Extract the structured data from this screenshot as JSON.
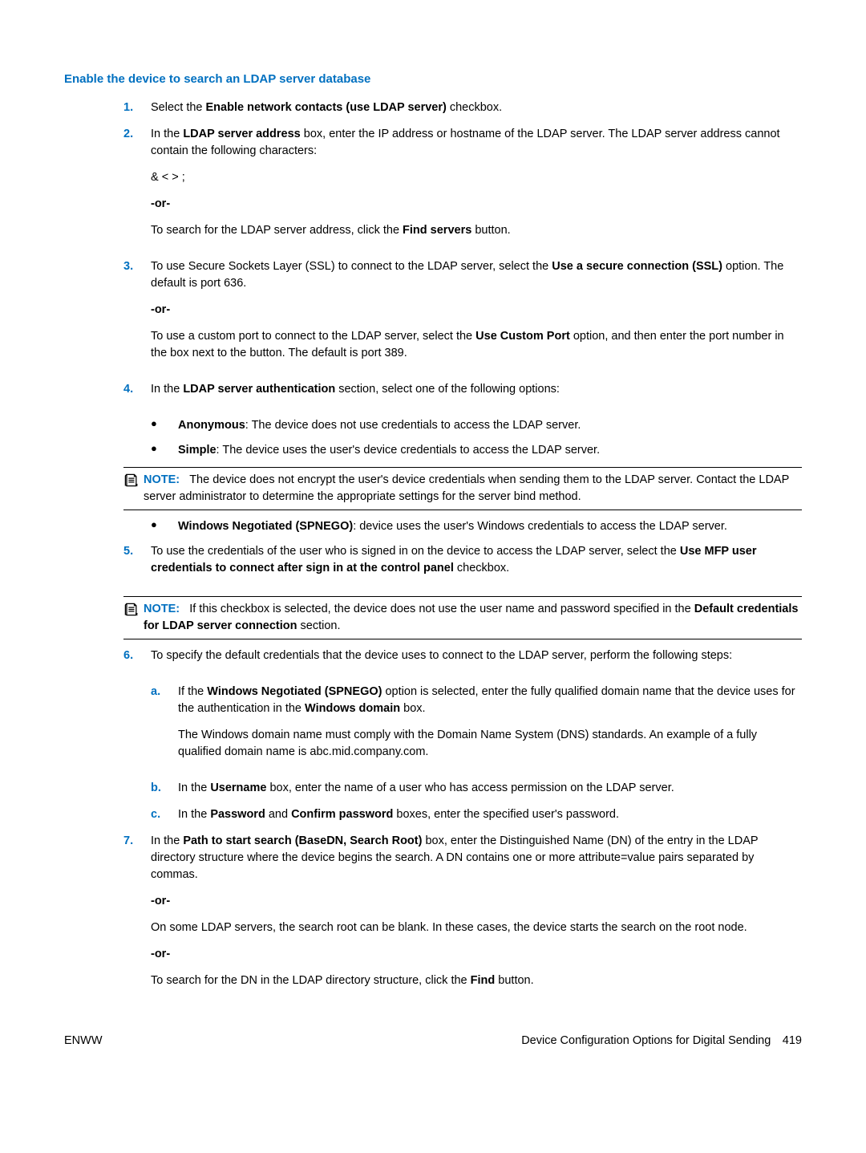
{
  "heading": "Enable the device to search an LDAP server database",
  "steps": {
    "s1": {
      "num": "1.",
      "text": "Select the <b>Enable network contacts (use LDAP server)</b> checkbox."
    },
    "s2": {
      "num": "2.",
      "text": "In the <b>LDAP server address</b> box, enter the IP address or hostname of the LDAP server. The LDAP server address cannot contain the following characters:",
      "chars": "& < > ;",
      "or": "-or-",
      "search": "To search for the LDAP server address, click the <b>Find servers</b> button."
    },
    "s3": {
      "num": "3.",
      "text": "To use Secure Sockets Layer (SSL) to connect to the LDAP server, select the <b>Use a secure connection (SSL)</b> option. The default is port 636.",
      "or": "-or-",
      "custom": "To use a custom port to connect to the LDAP server, select the <b>Use Custom Port</b> option, and then enter the port number in the box next to the button. The default is port 389."
    },
    "s4": {
      "num": "4.",
      "text": "In the <b>LDAP server authentication</b> section, select one of the following options:",
      "b1": "<b>Anonymous</b>: The device does not use credentials to access the LDAP server.",
      "b2": "<b>Simple</b>: The device uses the user's device credentials to access the LDAP server.",
      "note_label": "NOTE:",
      "note": "The device does not encrypt the user's device credentials when sending them to the LDAP server. Contact the LDAP server administrator to determine the appropriate settings for the server bind method.",
      "b3": "<b>Windows Negotiated (SPNEGO)</b>: device uses the user's Windows credentials to access the LDAP server."
    },
    "s5": {
      "num": "5.",
      "text": "To use the credentials of the user who is signed in on the device to access the LDAP server, select the <b>Use MFP user credentials to connect after sign in at the control panel</b> checkbox.",
      "note_label": "NOTE:",
      "note": "If this checkbox is selected, the device does not use the user name and password specified in the <b>Default credentials for LDAP server connection</b> section."
    },
    "s6": {
      "num": "6.",
      "text": "To specify the default credentials that the device uses to connect to the LDAP server, perform the following steps:",
      "a": {
        "num": "a.",
        "text": "If the <b>Windows Negotiated (SPNEGO)</b> option is selected, enter the fully qualified domain name that the device uses for the authentication in the <b>Windows domain</b> box.",
        "p2": "The Windows domain name must comply with the Domain Name System (DNS) standards. An example of a fully qualified domain name is abc.mid.company.com."
      },
      "b": {
        "num": "b.",
        "text": "In the <b>Username</b> box, enter the name of a user who has access permission on the LDAP server."
      },
      "c": {
        "num": "c.",
        "text": "In the <b>Password</b> and <b>Confirm password</b> boxes, enter the specified user's password."
      }
    },
    "s7": {
      "num": "7.",
      "text": "In the <b>Path to start search (BaseDN, Search Root)</b> box, enter the Distinguished Name (DN) of the entry in the LDAP directory structure where the device begins the search. A DN contains one or more attribute=value pairs separated by commas.",
      "or": "-or-",
      "p2": "On some LDAP servers, the search root can be blank. In these cases, the device starts the search on the root node.",
      "or2": "-or-",
      "p3": "To search for the DN in the LDAP directory structure, click the <b>Find</b> button."
    }
  },
  "footer": {
    "left": "ENWW",
    "right": "Device Configuration Options for Digital Sending 419"
  }
}
